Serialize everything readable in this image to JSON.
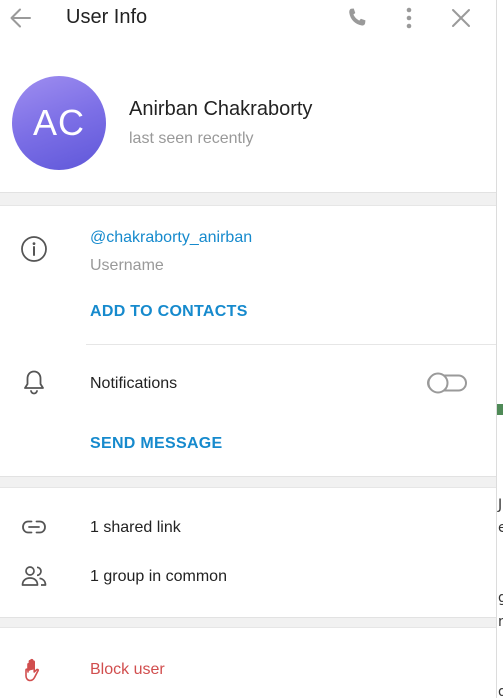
{
  "header": {
    "title": "User Info",
    "back_icon": "arrow-left-icon",
    "call_icon": "phone-icon",
    "more_icon": "more-vertical-icon",
    "close_icon": "close-icon"
  },
  "profile": {
    "initials": "AC",
    "name": "Anirban Chakraborty",
    "status": "last seen recently",
    "avatar_colors": [
      "#9f8ef0",
      "#5f57d9"
    ]
  },
  "info": {
    "username": "@chakraborty_anirban",
    "username_caption": "Username",
    "add_to_contacts": "ADD TO CONTACTS",
    "notifications_label": "Notifications",
    "notifications_enabled": false,
    "send_message": "SEND MESSAGE"
  },
  "media": {
    "shared_links": "1 shared link",
    "groups_in_common": "1 group in common"
  },
  "block": {
    "label": "Block user",
    "color": "#d14e4e"
  },
  "colors": {
    "accent": "#168acd",
    "muted": "#999999",
    "background": "#f1f1f1"
  },
  "background_window_glyphs": [
    "J",
    "e",
    "g",
    "n",
    "d"
  ]
}
